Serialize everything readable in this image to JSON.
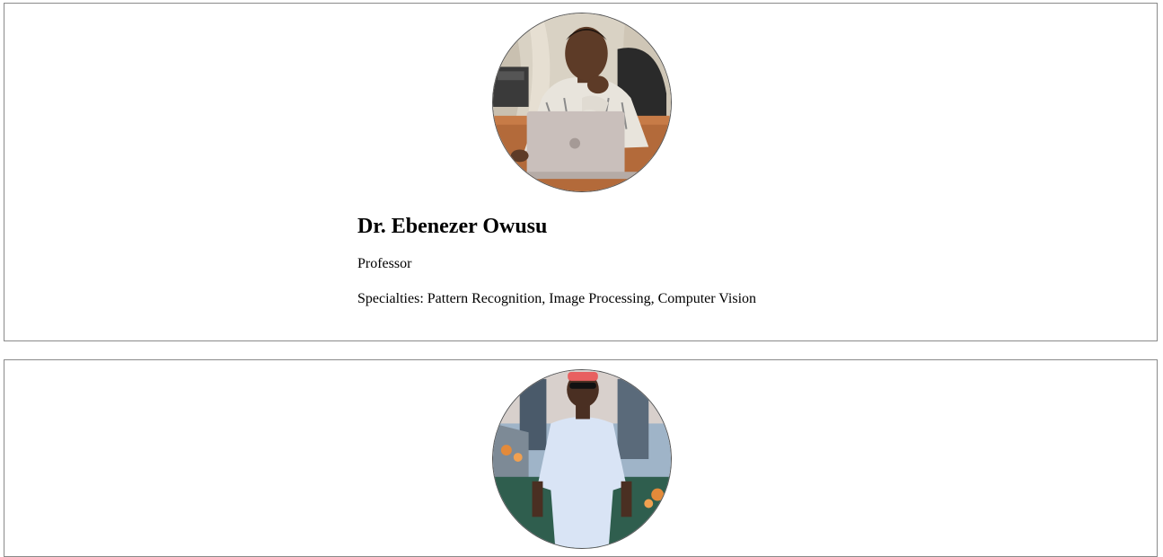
{
  "faculty": [
    {
      "name": "Dr. Ebenezer Owusu",
      "title": "Professor",
      "specialties": "Specialties: Pattern Recognition, Image Processing, Computer Vision",
      "photo_icon": "profile-photo"
    },
    {
      "name": "",
      "title": "",
      "specialties": "",
      "photo_icon": "profile-photo"
    }
  ],
  "colors": {
    "card_border": "#8a8a8a",
    "avatar_border": "#555555",
    "text": "#000000"
  }
}
